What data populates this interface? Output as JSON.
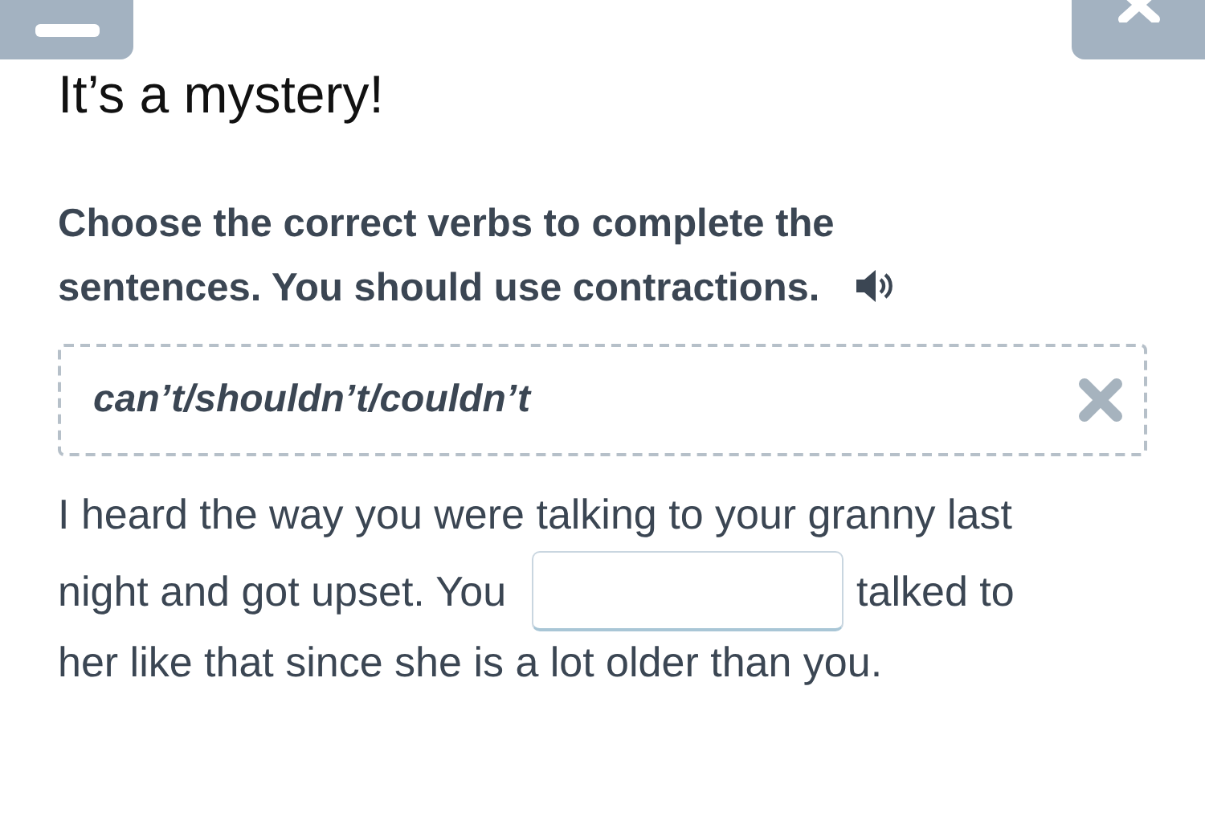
{
  "title": "It’s a mystery!",
  "instruction": "Choose the correct verbs to complete the sentences. You should use contractions.",
  "word_box": {
    "text": "can’t/shouldn’t/couldn’t"
  },
  "sentence": {
    "before": [
      "I heard the way you were talking to your granny last",
      "night and got upset. You"
    ],
    "after": [
      "talked to",
      "her like that since she is a lot older than you."
    ]
  }
}
